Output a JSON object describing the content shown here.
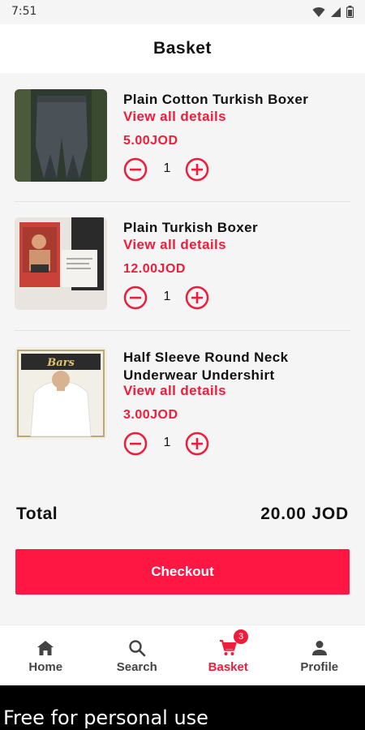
{
  "status": {
    "time": "7:51"
  },
  "header": {
    "title": "Basket"
  },
  "items": [
    {
      "title": "Plain Cotton Turkish Boxer",
      "details": "View all details",
      "price": "5.00JOD",
      "qty": "1"
    },
    {
      "title": "Plain Turkish Boxer",
      "details": "View all details",
      "price": "12.00JOD",
      "qty": "1"
    },
    {
      "title": "Half Sleeve Round Neck Underwear Undershirt",
      "details": "View all details",
      "price": "3.00JOD",
      "qty": "1",
      "image_text": "Bars"
    }
  ],
  "summary": {
    "total_label": "Total",
    "total_value": "20.00 JOD",
    "checkout_label": "Checkout"
  },
  "nav": {
    "home": "Home",
    "search": "Search",
    "basket": "Basket",
    "basket_badge": "3",
    "profile": "Profile"
  },
  "footer": {
    "watermark": "Free for personal use"
  },
  "colors": {
    "accent": "#ee1d3b",
    "checkout": "#ff1744"
  }
}
